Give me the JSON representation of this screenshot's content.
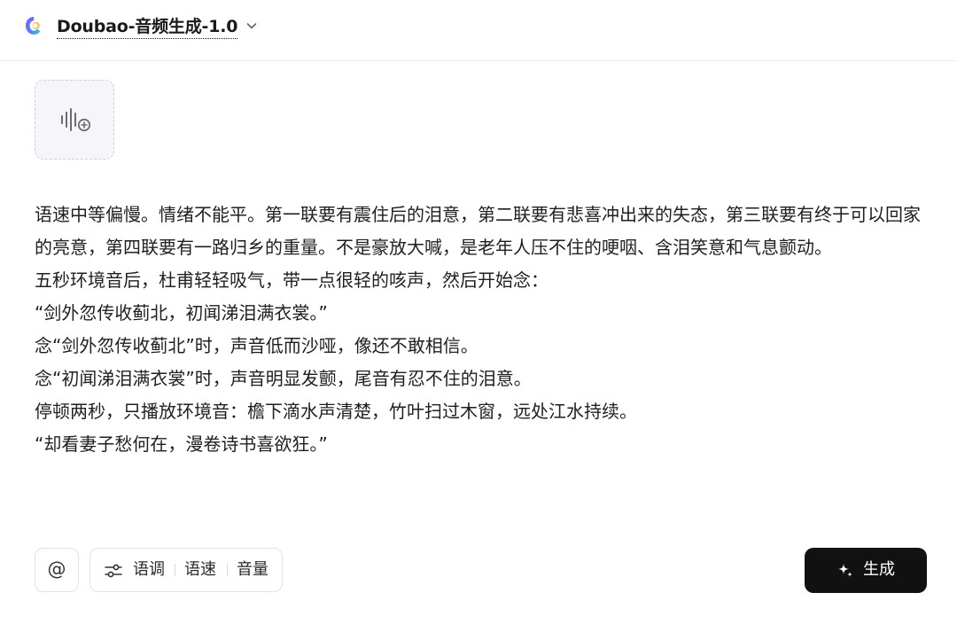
{
  "header": {
    "model_name": "Doubao-音频生成-1.0",
    "logo_icon": "doubao-logo-icon",
    "dropdown_icon": "chevron-down-icon"
  },
  "upload": {
    "icon": "audio-upload-icon"
  },
  "prompt": {
    "lines": [
      "语速中等偏慢。情绪不能平。第一联要有震住后的泪意，第二联要有悲喜冲出来的失态，第三联要有终于可以回家的亮意，第四联要有一路归乡的重量。不是豪放大喊，是老年人压不住的哽咽、含泪笑意和气息颤动。",
      "五秒环境音后，杜甫轻轻吸气，带一点很轻的咳声，然后开始念：",
      "“剑外忽传收蓟北，初闻涕泪满衣裳。”",
      "念“剑外忽传收蓟北”时，声音低而沙哑，像还不敢相信。",
      "念“初闻涕泪满衣裳”时，声音明显发颤，尾音有忍不住的泪意。",
      "停顿两秒，只播放环境音：檐下滴水声清楚，竹叶扫过木窗，远处江水持续。",
      "“却看妻子愁何在，漫卷诗书喜欲狂。”"
    ]
  },
  "toolbar": {
    "at_label": "@",
    "params_icon": "sliders-icon",
    "params": [
      "语调",
      "语速",
      "音量"
    ],
    "generate_label": "生成",
    "generate_icon": "sparkle-icon"
  },
  "colors": {
    "accent": "#111111",
    "upload_bg": "#f6f6fa",
    "border": "#e2e2e2"
  }
}
